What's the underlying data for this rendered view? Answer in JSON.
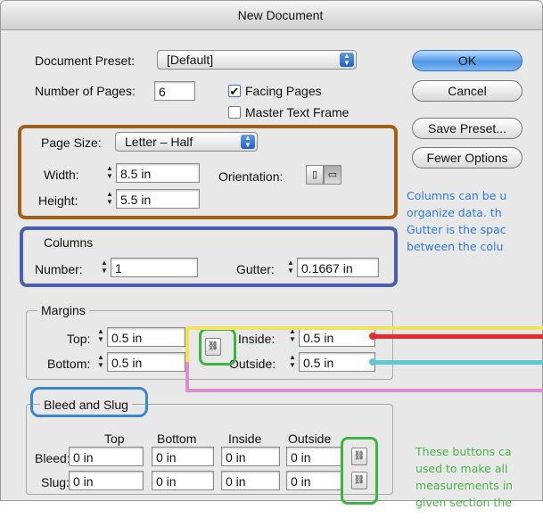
{
  "window": {
    "title": "New Document"
  },
  "preset": {
    "label": "Document Preset:",
    "value": "[Default]"
  },
  "pages": {
    "label": "Number of Pages:",
    "value": "6"
  },
  "checkboxes": {
    "facing_pages": "Facing Pages",
    "master_text_frame": "Master Text Frame"
  },
  "buttons": {
    "ok": "OK",
    "cancel": "Cancel",
    "save_preset": "Save Preset...",
    "fewer_options": "Fewer Options"
  },
  "page_size": {
    "label": "Page Size:",
    "value": "Letter – Half",
    "width_label": "Width:",
    "width": "8.5 in",
    "height_label": "Height:",
    "height": "5.5 in",
    "orientation_label": "Orientation:"
  },
  "columns": {
    "title": "Columns",
    "number_label": "Number:",
    "number": "1",
    "gutter_label": "Gutter:",
    "gutter": "0.1667 in"
  },
  "margins": {
    "title": "Margins",
    "top_label": "Top:",
    "top": "0.5 in",
    "bottom_label": "Bottom:",
    "bottom": "0.5 in",
    "inside_label": "Inside:",
    "inside": "0.5 in",
    "outside_label": "Outside:",
    "outside": "0.5 in"
  },
  "bleed_slug": {
    "title": "Bleed and Slug",
    "headers": [
      "Top",
      "Bottom",
      "Inside",
      "Outside"
    ],
    "bleed_label": "Bleed:",
    "bleed": [
      "0 in",
      "0 in",
      "0 in",
      "0 in"
    ],
    "slug_label": "Slug:",
    "slug": [
      "0 in",
      "0 in",
      "0 in",
      "0 in"
    ]
  },
  "notes": {
    "columns": [
      "Columns can be u",
      "organize data. th",
      "Gutter is the spac",
      "between the colu"
    ],
    "buttons": [
      "These buttons ca",
      "used to make all ",
      "measurements in",
      "given section the"
    ]
  },
  "colors": {
    "page_size_box": "#a0601a",
    "columns_box": "#4a5fb0",
    "bleed_box": "#3a86d0",
    "chain_box": "#3fb33f",
    "top_line": "#f2e35a",
    "inside_line": "#e32b2b",
    "outside_line": "#5fc8d0",
    "bottom_line": "#d88fcf",
    "note_blue": "#2f7ad8",
    "note_green": "#4ab34a"
  }
}
